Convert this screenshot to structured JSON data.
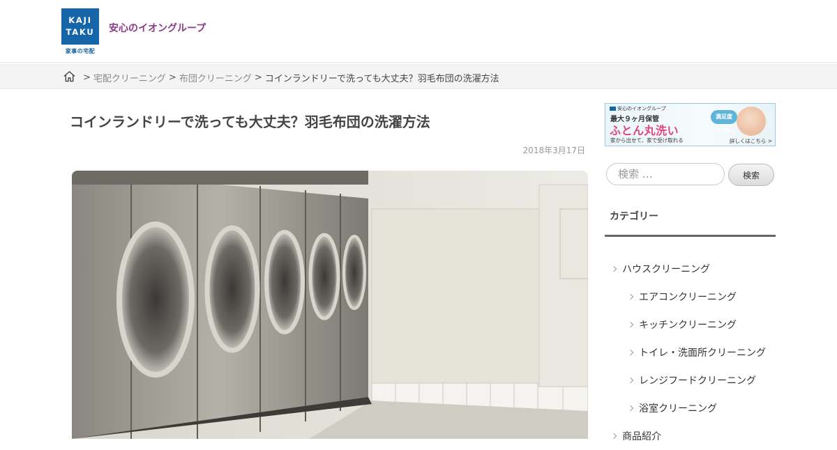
{
  "header": {
    "logo_line1": "KAJI",
    "logo_line2": "TAKU",
    "logo_sub": "家事の宅配",
    "tagline": "安心のイオングループ"
  },
  "breadcrumb": {
    "home_icon": "home-icon",
    "separator": ">",
    "items": [
      "宅配クリーニング",
      "布団クリーニング"
    ],
    "current": "コインランドリーで洗っても大丈夫？羽毛布団の洗濯方法"
  },
  "post": {
    "title": "コインランドリーで洗っても大丈夫？羽毛布団の洗濯方法",
    "date": "2018年3月17日",
    "hero_image": "laundromat-washing-machines-photo"
  },
  "sidebar": {
    "banner": {
      "top": "安心のイオングループ",
      "subtitle": "最大９ヶ月保管",
      "title": "ふとん丸洗い",
      "note": "家から出せて、家で受け取れる",
      "badge": "満足度 97%",
      "link": "詳しくはこちら >"
    },
    "search": {
      "placeholder": "検索 …",
      "button": "検索"
    },
    "categories": {
      "heading": "カテゴリー",
      "items": [
        {
          "label": "ハウスクリーニング",
          "level": 1
        },
        {
          "label": "エアコンクリーニング",
          "level": 2
        },
        {
          "label": "キッチンクリーニング",
          "level": 2
        },
        {
          "label": "トイレ・洗面所クリーニング",
          "level": 2
        },
        {
          "label": "レンジフードクリーニング",
          "level": 2
        },
        {
          "label": "浴室クリーニング",
          "level": 2
        },
        {
          "label": "商品紹介",
          "level": 1
        }
      ]
    }
  },
  "colors": {
    "brand_blue": "#1565a8",
    "tagline_purple": "#8a3a86",
    "banner_pink": "#e0457b"
  }
}
